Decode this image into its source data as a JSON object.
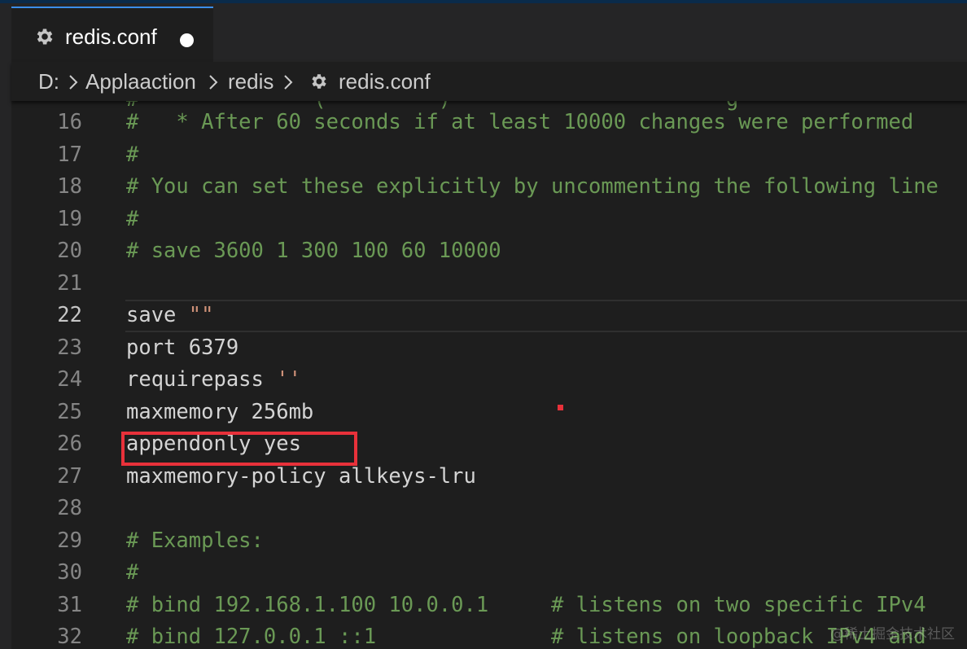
{
  "tab": {
    "icon": "gear-icon",
    "label": "redis.conf",
    "modified_indicator": "dot-icon"
  },
  "breadcrumb": {
    "items": [
      "D:",
      "Applaaction",
      "redis",
      "redis.conf"
    ],
    "file_icon": "gear-icon",
    "separator_icon": "chevron-right-icon"
  },
  "editor": {
    "partial_top_line": "#              (         )                      g",
    "lines": [
      {
        "number": "16",
        "text": "#   * After 60 seconds if at least 10000 changes were performed",
        "kind": "comment"
      },
      {
        "number": "17",
        "text": "#",
        "kind": "comment"
      },
      {
        "number": "18",
        "text": "# You can set these explicitly by uncommenting the following line",
        "kind": "comment"
      },
      {
        "number": "19",
        "text": "#",
        "kind": "comment"
      },
      {
        "number": "20",
        "text": "# save 3600 1 300 100 60 10000",
        "kind": "comment"
      },
      {
        "number": "21",
        "text": "",
        "kind": "plain"
      },
      {
        "number": "22",
        "text_parts": [
          "save ",
          "\"\""
        ],
        "kind": "string",
        "active": true
      },
      {
        "number": "23",
        "text": "port 6379",
        "kind": "plain"
      },
      {
        "number": "24",
        "text_parts": [
          "requirepass ",
          "''"
        ],
        "kind": "string"
      },
      {
        "number": "25",
        "text": "maxmemory 256mb",
        "kind": "plain"
      },
      {
        "number": "26",
        "text": "appendonly yes",
        "kind": "plain",
        "highlighted": true
      },
      {
        "number": "27",
        "text": "maxmemory-policy allkeys-lru",
        "kind": "plain"
      },
      {
        "number": "28",
        "text": "",
        "kind": "plain"
      },
      {
        "number": "29",
        "text": "# Examples:",
        "kind": "comment"
      },
      {
        "number": "30",
        "text": "#",
        "kind": "comment"
      },
      {
        "number": "31",
        "text": "# bind 192.168.1.100 10.0.0.1     # listens on two specific IPv4",
        "kind": "comment"
      },
      {
        "number": "32",
        "text": "# bind 127.0.0.1 ::1              # listens on loopback IPv4 and",
        "kind": "comment"
      }
    ]
  },
  "watermark": "@稀土掘金技术社区",
  "colors": {
    "comment": "#6a9955",
    "plain": "#d4d4d4",
    "string": "#ce9178",
    "annotation": "#e8313a",
    "tab_accent": "#3b8eea"
  }
}
